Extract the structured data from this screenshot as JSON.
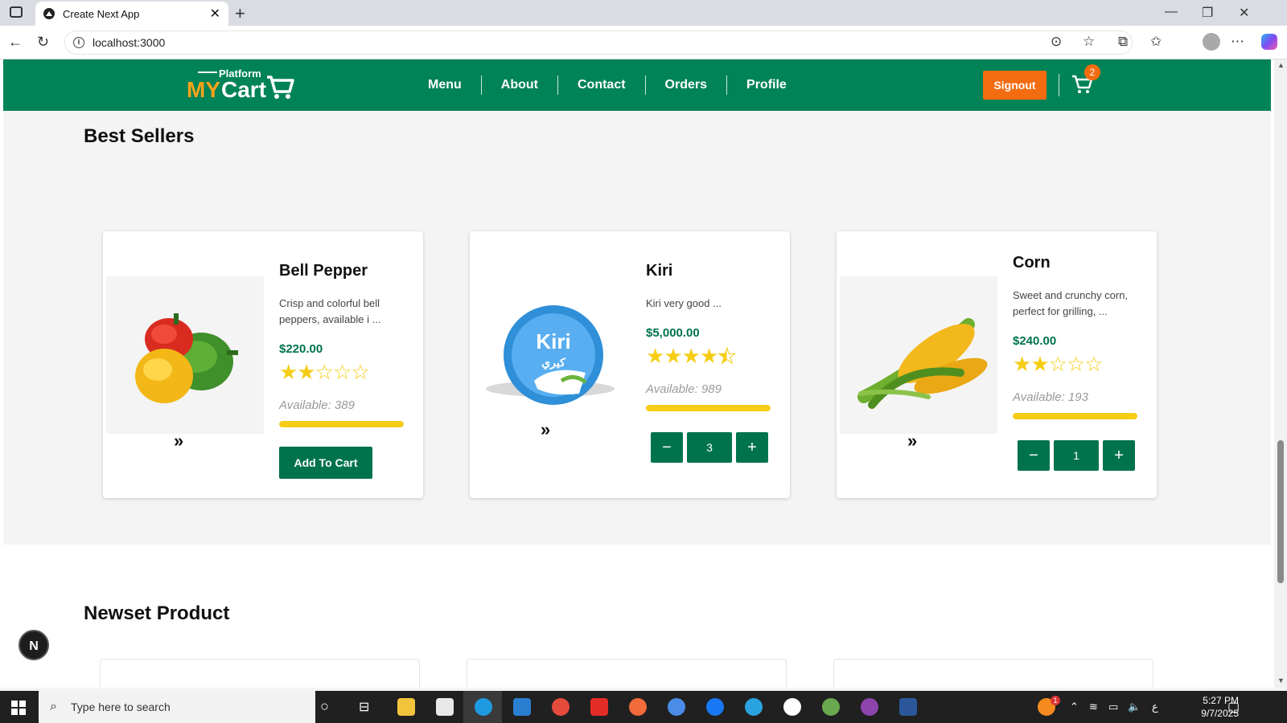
{
  "browser": {
    "tab_title": "Create Next App",
    "tab_close": "✕",
    "new_tab": "+",
    "url": "localhost:3000",
    "window_controls": [
      "—",
      "❐",
      "✕"
    ]
  },
  "header": {
    "logo_small": "Platform",
    "logo_my": "MY",
    "logo_cart": "Cart",
    "nav": [
      "Menu",
      "About",
      "Contact",
      "Orders",
      "Profile"
    ],
    "signout_label": "Signout",
    "cart_count": "2"
  },
  "best_sellers": {
    "title": "Best Sellers",
    "products": [
      {
        "name": "Bell Pepper",
        "description": "Crisp and colorful bell peppers, available i ...",
        "price": "$220.00",
        "rating": 2,
        "rating_max": 5,
        "available": "Available: 389",
        "stock_level": 1.0,
        "action": "Add To Cart"
      },
      {
        "name": "Kiri",
        "description": "Kiri very good ...",
        "price": "$5,000.00",
        "rating": 4.5,
        "rating_max": 5,
        "available": "Available: 989",
        "stock_level": 1.0,
        "quantity": "3",
        "minus": "−",
        "plus": "+"
      },
      {
        "name": "Corn",
        "description": "Sweet and crunchy corn, perfect for grilling, ...",
        "price": "$240.00",
        "rating": 2,
        "rating_max": 5,
        "available": "Available: 193",
        "stock_level": 1.0,
        "quantity": "1",
        "minus": "−",
        "plus": "+"
      }
    ],
    "next_icon": "»"
  },
  "newest": {
    "title": "Newset Product"
  },
  "dev_badge": "N",
  "taskbar": {
    "search_placeholder": "Type here to search",
    "time": "5:27 PM",
    "date": "9/7/2025",
    "lang": "ع",
    "notif_count": "1"
  },
  "colors": {
    "brand_green": "#008357",
    "button_green": "#00734d",
    "accent_orange": "#f36c10",
    "star_yellow": "#f5cd17"
  }
}
